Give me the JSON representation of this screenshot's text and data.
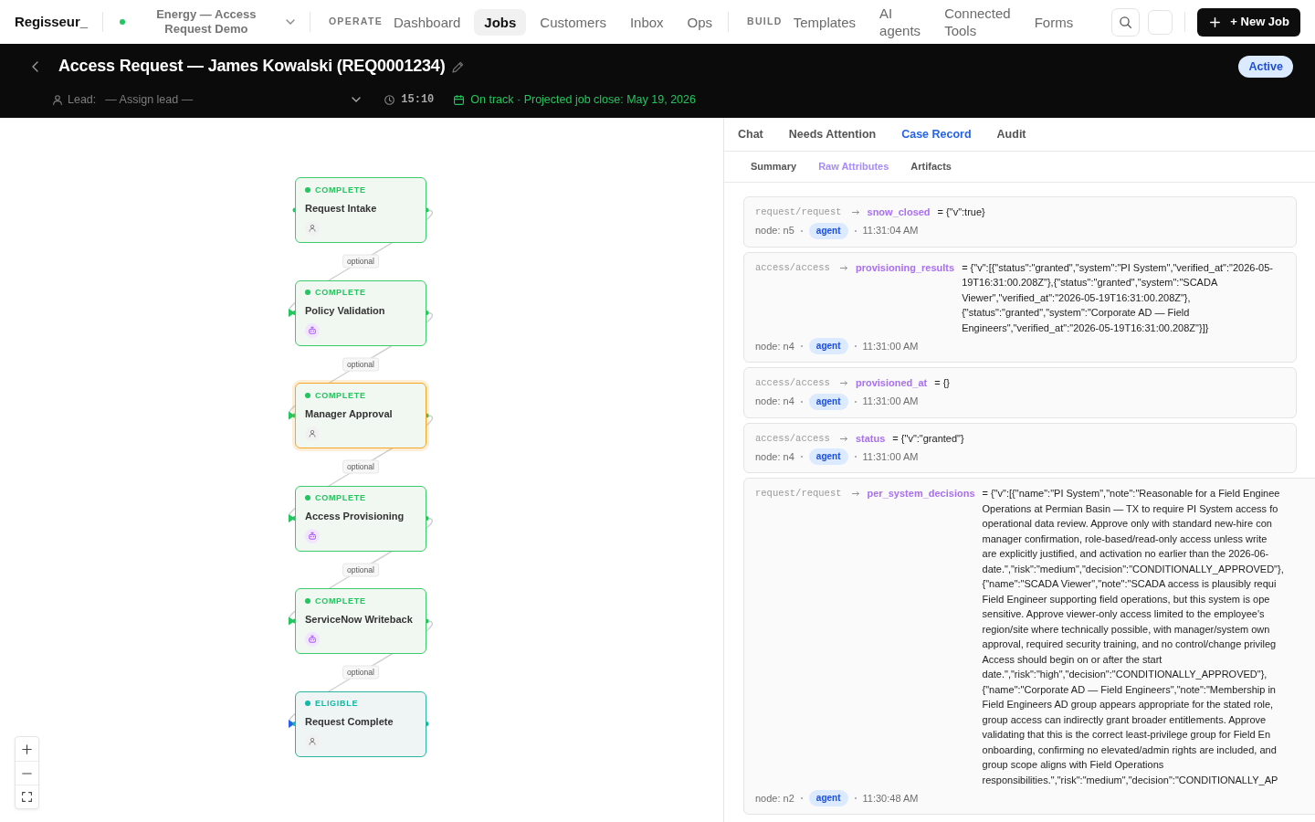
{
  "app": {
    "name": "Regisseur_"
  },
  "workspace": {
    "name": "Energy — Access Request Demo"
  },
  "nav": [
    {
      "section": "OPERATE",
      "items": [
        {
          "label": "Dashboard",
          "selected": false
        },
        {
          "label": "Jobs",
          "selected": true
        },
        {
          "label": "Customers",
          "selected": false
        },
        {
          "label": "Inbox",
          "selected": false
        },
        {
          "label": "Ops",
          "selected": false
        }
      ]
    },
    {
      "section": "BUILD",
      "items": [
        {
          "label": "Templates",
          "selected": false
        },
        {
          "label": "AI agents",
          "selected": false
        },
        {
          "label": "Connected Tools",
          "selected": false
        },
        {
          "label": "Forms",
          "selected": false
        }
      ]
    }
  ],
  "new_job_button": "+ New Job",
  "job": {
    "title": "Access Request — James Kowalski (REQ0001234)",
    "status": "Active",
    "lead": {
      "label": "Lead:",
      "placeholder": "— Assign lead —"
    },
    "timer": "15:10",
    "schedule": "On track · Projected job close: May 19, 2026"
  },
  "flow": {
    "nodes": [
      {
        "status": "COMPLETE",
        "kind": "complete",
        "title": "Request Intake",
        "automated": false,
        "selected": false
      },
      {
        "status": "COMPLETE",
        "kind": "complete",
        "title": "Policy Validation",
        "automated": true,
        "selected": false
      },
      {
        "status": "COMPLETE",
        "kind": "complete",
        "title": "Manager Approval",
        "automated": false,
        "selected": true
      },
      {
        "status": "COMPLETE",
        "kind": "complete",
        "title": "Access Provisioning",
        "automated": true,
        "selected": false
      },
      {
        "status": "COMPLETE",
        "kind": "complete",
        "title": "ServiceNow Writeback",
        "automated": true,
        "selected": false
      },
      {
        "status": "ELIGIBLE",
        "kind": "eligible",
        "title": "Request Complete",
        "automated": false,
        "selected": false
      }
    ],
    "edges": [
      {
        "label": "optional"
      },
      {
        "label": "optional"
      },
      {
        "label": "optional"
      },
      {
        "label": "optional"
      },
      {
        "label": "optional"
      }
    ]
  },
  "panel": {
    "tabs": [
      {
        "label": "Chat",
        "selected": false
      },
      {
        "label": "Needs Attention",
        "selected": false
      },
      {
        "label": "Case Record",
        "selected": true
      },
      {
        "label": "Audit",
        "selected": false
      }
    ],
    "subtabs": [
      {
        "label": "Summary",
        "selected": false
      },
      {
        "label": "Raw Attributes",
        "selected": true
      },
      {
        "label": "Artifacts",
        "selected": false
      }
    ],
    "attributes": [
      {
        "source": "request/request",
        "key": "snow_closed",
        "value": "= {\"v\":true}",
        "node": "node: n5",
        "actor": "agent",
        "time": "11:31:04 AM"
      },
      {
        "source": "access/access",
        "key": "provisioning_results",
        "value": "= {\"v\":[{\"status\":\"granted\",\"system\":\"PI System\",\"verified_at\":\"2026-05-19T16:31:00.208Z\"},{\"status\":\"granted\",\"system\":\"SCADA Viewer\",\"verified_at\":\"2026-05-19T16:31:00.208Z\"},{\"status\":\"granted\",\"system\":\"Corporate AD — Field Engineers\",\"verified_at\":\"2026-05-19T16:31:00.208Z\"}]}",
        "node": "node: n4",
        "actor": "agent",
        "time": "11:31:00 AM"
      },
      {
        "source": "access/access",
        "key": "provisioned_at",
        "value": "= {}",
        "node": "node: n4",
        "actor": "agent",
        "time": "11:31:00 AM"
      },
      {
        "source": "access/access",
        "key": "status",
        "value": "= {\"v\":\"granted\"}",
        "node": "node: n4",
        "actor": "agent",
        "time": "11:31:00 AM"
      },
      {
        "source": "request/request",
        "key": "per_system_decisions",
        "value_lines": [
          "= {\"v\":[{\"name\":\"PI System\",\"note\":\"Reasonable for a Field Enginee",
          "Operations at Permian Basin — TX to require PI System access fo",
          "operational data review. Approve only with standard new-hire con",
          "manager confirmation, role-based/read-only access unless write",
          "are explicitly justified, and activation no earlier than the 2026-06-",
          "date.\",\"risk\":\"medium\",\"decision\":\"CONDITIONALLY_APPROVED\"},",
          "{\"name\":\"SCADA Viewer\",\"note\":\"SCADA access is plausibly requi",
          "Field Engineer supporting field operations, but this system is ope",
          "sensitive. Approve viewer-only access limited to the employee's",
          "region/site where technically possible, with manager/system own",
          "approval, required security training, and no control/change privileg",
          "Access should begin on or after the start",
          "date.\",\"risk\":\"high\",\"decision\":\"CONDITIONALLY_APPROVED\"},",
          "{\"name\":\"Corporate AD — Field Engineers\",\"note\":\"Membership in",
          "Field Engineers AD group appears appropriate for the stated role,",
          "group access can indirectly grant broader entitlements. Approve",
          "validating that this is the correct least-privilege group for Field En",
          "onboarding, confirming no elevated/admin rights are included, and",
          "group scope aligns with Field Operations",
          "responsibilities.\",\"risk\":\"medium\",\"decision\":\"CONDITIONALLY_AP"
        ],
        "node": "node: n2",
        "actor": "agent",
        "time": "11:30:48 AM"
      }
    ]
  }
}
